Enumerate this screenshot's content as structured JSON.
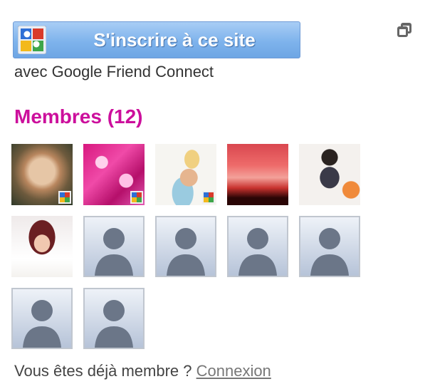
{
  "signup": {
    "button_label": "S'inscrire à ce site",
    "subtitle": "avec Google Friend Connect"
  },
  "icons": {
    "logo": "google-friend-connect-icon",
    "popout": "popout-window-icon",
    "badge": "google-badge-icon",
    "default_avatar": "person-silhouette-icon"
  },
  "members": {
    "title": "Membres (12)",
    "items": [
      {
        "type": "photo",
        "badge": true
      },
      {
        "type": "photo",
        "badge": true
      },
      {
        "type": "photo",
        "badge": true
      },
      {
        "type": "photo",
        "badge": false
      },
      {
        "type": "photo",
        "badge": false
      },
      {
        "type": "photo",
        "badge": false
      },
      {
        "type": "default",
        "badge": false
      },
      {
        "type": "default",
        "badge": false
      },
      {
        "type": "default",
        "badge": false
      },
      {
        "type": "default",
        "badge": false
      },
      {
        "type": "default",
        "badge": false
      },
      {
        "type": "default",
        "badge": false
      }
    ]
  },
  "footer": {
    "text": "Vous êtes déjà membre ?",
    "link": "Connexion"
  },
  "colors": {
    "title": "#cc0f9c",
    "button": "#7eb3ec"
  }
}
